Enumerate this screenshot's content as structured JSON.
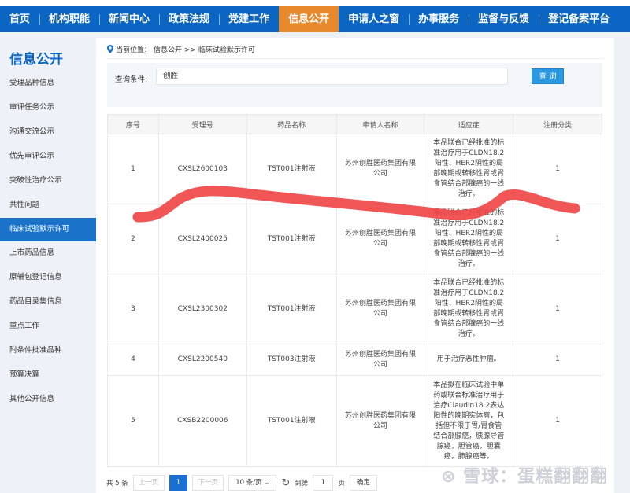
{
  "nav": {
    "items": [
      "首页",
      "机构职能",
      "新闻中心",
      "政策法规",
      "党建工作",
      "信息公开",
      "申请人之窗",
      "办事服务",
      "监督与反馈",
      "登记备案平台"
    ],
    "active": 5
  },
  "sidebar": {
    "title": "信息公开",
    "items": [
      "受理品种信息",
      "审评任务公示",
      "沟通交流公示",
      "优先审评公示",
      "突破性治疗公示",
      "共性问题",
      "临床试验默示许可",
      "上市药品信息",
      "原辅包登记信息",
      "药品目录集信息",
      "重点工作",
      "附条件批准品种",
      "预算决算",
      "其他公开信息"
    ],
    "active": 6
  },
  "breadcrumb": {
    "label": "当前位置：",
    "path": "信息公开 >> 临床试验默示许可"
  },
  "search": {
    "label": "查询条件:",
    "value": "创胜",
    "button": "查 询"
  },
  "table": {
    "headers": [
      "序号",
      "受理号",
      "药品名称",
      "申请人名称",
      "适应症",
      "注册分类"
    ],
    "rows": [
      [
        "1",
        "CXSL2600103",
        "TST001注射液",
        "苏州创胜医药集团有限公司",
        "本品联合已经批准的标准治疗用于CLDN18.2阳性、HER2阴性的局部晚期或转移性胃或胃食管结合部腺癌的一线治疗。",
        "1"
      ],
      [
        "2",
        "CXSL2400025",
        "TST001注射液",
        "苏州创胜医药集团有限公司",
        "本品联合已经批准的标准治疗用于CLDN18.2阳性、HER2阴性的局部晚期或转移性胃或胃食管结合部腺癌的一线治疗。",
        "1"
      ],
      [
        "3",
        "CXSL2300302",
        "TST001注射液",
        "苏州创胜医药集团有限公司",
        "本品联合已经批准的标准治疗用于CLDN18.2阳性、HER2阴性的局部晚期或转移性胃或胃食管结合部腺癌的一线治疗。",
        "1"
      ],
      [
        "4",
        "CXSL2200540",
        "TST003注射液",
        "苏州创胜医药集团有限公司",
        "用于治疗恶性肿瘤。",
        "1"
      ],
      [
        "5",
        "CXSB2200006",
        "TST001注射液",
        "苏州创胜医药集团有限公司",
        "本品拟在临床试验中单药或联合标准治疗用于治疗Claudin18.2表达阳性的晚期实体瘤，包括但不限于胃/胃食管结合部腺癌，胰腺导管腺癌，胆管癌，胆囊癌，肺腺癌等。",
        "1"
      ]
    ]
  },
  "pager": {
    "total": "共 5 条",
    "prev": "上一页",
    "current": "1",
    "next": "下一页",
    "page_size": "10 条/页",
    "goto": "到第",
    "goto_value": "1",
    "page_unit": "页",
    "confirm": "确定"
  },
  "watermark": "雪球：蛋糕翻翻翻",
  "colors": {
    "nav": "#0b66c3",
    "active_nav": "#e8892c",
    "scribble": "#f04848"
  }
}
